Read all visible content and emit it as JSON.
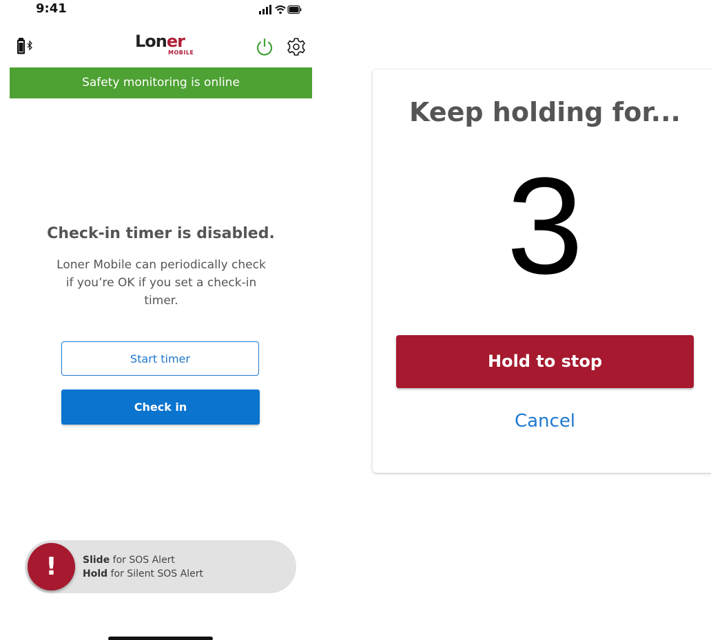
{
  "status_bar": {
    "time": "9:41"
  },
  "header": {
    "logo_main_part1": "Lon",
    "logo_main_part2": "er",
    "logo_sub": "MOBILE"
  },
  "banner": {
    "text": "Safety monitoring is online",
    "color": "#4ea133"
  },
  "timer": {
    "heading": "Check-in timer is disabled.",
    "description": "Loner Mobile can periodically check if you’re OK if you set a check-in timer.",
    "start_label": "Start timer",
    "checkin_label": "Check in"
  },
  "sos": {
    "icon_glyph": "!",
    "slide_bold": "Slide",
    "slide_rest": " for SOS Alert",
    "hold_bold": "Hold",
    "hold_rest": " for Silent SOS Alert"
  },
  "modal": {
    "title": "Keep holding for...",
    "countdown": "3",
    "hold_label": "Hold to stop",
    "cancel_label": "Cancel",
    "accent_color": "#a6192e"
  },
  "icons": [
    "bluetooth-battery-icon",
    "power-icon",
    "gear-icon",
    "signal-icon",
    "wifi-icon",
    "battery-icon"
  ]
}
